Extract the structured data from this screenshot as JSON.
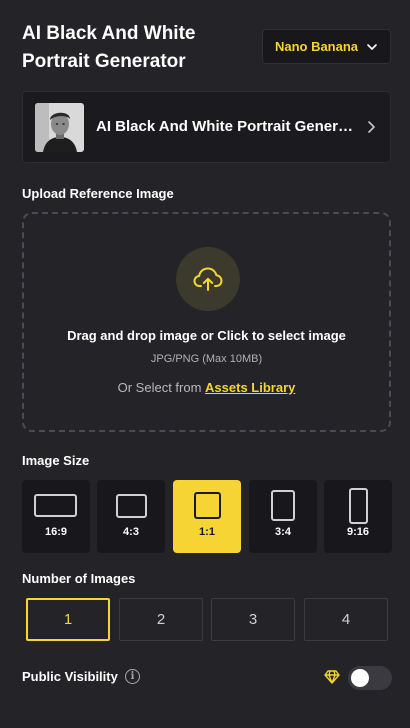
{
  "header": {
    "title": "AI Black And White Portrait Generator",
    "model_select": {
      "value": "Nano Banana",
      "icon": "chevron-down-icon"
    }
  },
  "preset": {
    "name": "AI Black And White Portrait Generator",
    "icon": "chevron-right-icon"
  },
  "upload": {
    "section_label": "Upload Reference Image",
    "icon": "cloud-upload-icon",
    "main_text": "Drag and drop image or Click to select image",
    "hint": "JPG/PNG (Max 10MB)",
    "assets_prefix": "Or Select from",
    "assets_link": "Assets Library"
  },
  "image_size": {
    "section_label": "Image Size",
    "selected": "1:1",
    "options": [
      {
        "label": "16:9"
      },
      {
        "label": "4:3"
      },
      {
        "label": "1:1"
      },
      {
        "label": "3:4"
      },
      {
        "label": "9:16"
      }
    ]
  },
  "number_of_images": {
    "section_label": "Number of Images",
    "selected": "1",
    "options": [
      "1",
      "2",
      "3",
      "4"
    ]
  },
  "visibility": {
    "label": "Public Visibility",
    "info_icon": "info-icon",
    "premium_icon": "diamond-icon",
    "enabled": false
  },
  "colors": {
    "background": "#232328",
    "accent": "#f5d433",
    "card": "#18181c"
  }
}
